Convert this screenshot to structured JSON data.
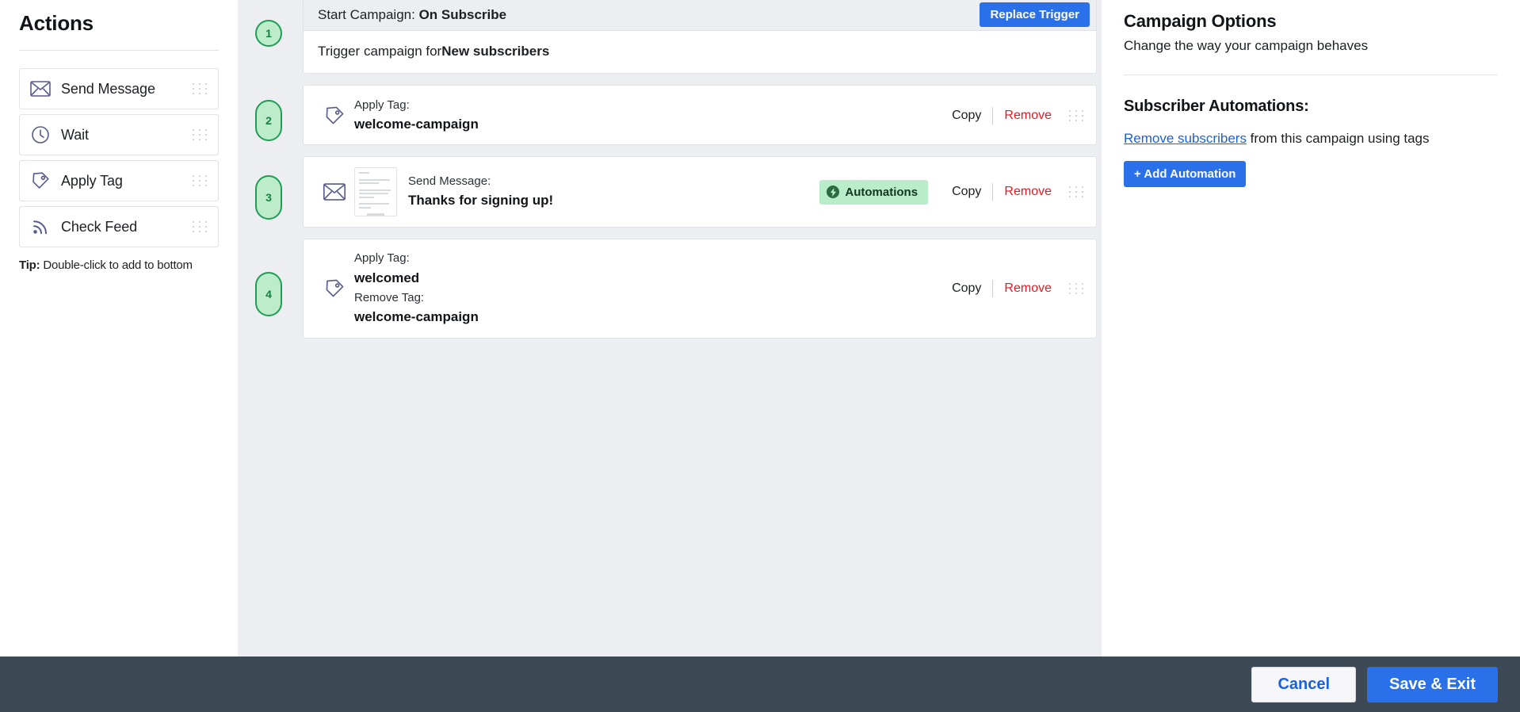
{
  "sidebar": {
    "title": "Actions",
    "items": [
      {
        "label": "Send Message",
        "icon": "envelope-icon"
      },
      {
        "label": "Wait",
        "icon": "clock-icon"
      },
      {
        "label": "Apply Tag",
        "icon": "tag-icon"
      },
      {
        "label": "Check Feed",
        "icon": "rss-icon"
      }
    ],
    "tip_label": "Tip:",
    "tip_text": " Double-click to add to bottom"
  },
  "canvas": {
    "steps": [
      {
        "number": "1",
        "type": "trigger",
        "header_prefix": "Start Campaign: ",
        "header_value": "On Subscribe",
        "replace_trigger_label": "Replace Trigger",
        "body_prefix": "Trigger campaign for ",
        "body_value": "New subscribers"
      },
      {
        "number": "2",
        "type": "apply-tag",
        "icon": "tag-icon",
        "sub": "Apply Tag:",
        "main": "welcome-campaign",
        "copy_label": "Copy",
        "remove_label": "Remove"
      },
      {
        "number": "3",
        "type": "send-message",
        "icon": "envelope-icon",
        "sub": "Send Message:",
        "main": "Thanks for signing up!",
        "automations_label": "Automations",
        "copy_label": "Copy",
        "remove_label": "Remove"
      },
      {
        "number": "4",
        "type": "apply-remove-tag",
        "icon": "tag-icon",
        "sub": "Apply Tag:",
        "main": "welcomed",
        "sub2": "Remove Tag:",
        "main2": "welcome-campaign",
        "copy_label": "Copy",
        "remove_label": "Remove"
      }
    ]
  },
  "right_panel": {
    "title": "Campaign Options",
    "subtitle": "Change the way your campaign behaves",
    "section_title": "Subscriber Automations:",
    "link_text": "Remove subscribers",
    "line_rest": " from this campaign using tags",
    "add_automation_label": "+ Add Automation"
  },
  "footer": {
    "cancel_label": "Cancel",
    "save_label": "Save & Exit"
  },
  "colors": {
    "accent_blue": "#2a70e8",
    "danger_red": "#e01b24",
    "badge_green_bg": "#bdeccb",
    "badge_green_border": "#1f9d54",
    "automations_bg": "#b9ecc8",
    "footer_bg": "#3d4a56",
    "canvas_bg": "#eceef1"
  }
}
